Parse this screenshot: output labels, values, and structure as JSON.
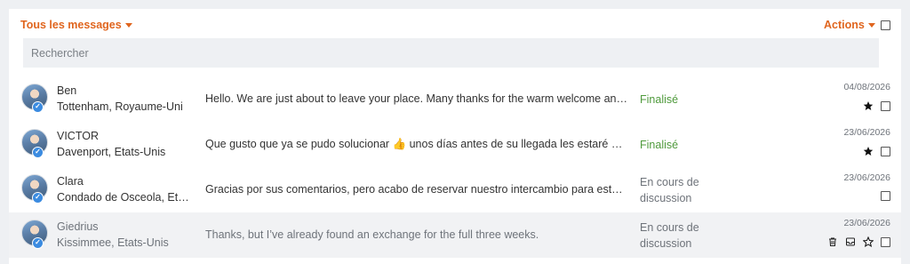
{
  "header": {
    "filter_label": "Tous les messages",
    "actions_label": "Actions"
  },
  "search": {
    "placeholder": "Rechercher"
  },
  "messages": [
    {
      "name": "Ben",
      "location": "Tottenham, Royaume-Uni",
      "preview": "Hello. We are just about to leave your place. Many thanks for the warm welcome and the great exchange!",
      "status": "Finalisé",
      "date": "04/08/2026",
      "starred": true
    },
    {
      "name": "VICTOR",
      "location": "Davenport, Etats-Unis",
      "preview": "Que gusto que ya se pudo solucionar 👍 unos días antes de su llegada les estaré enviando la información",
      "status": "Finalisé",
      "date": "23/06/2026",
      "starred": true
    },
    {
      "name": "Clara",
      "location": "Condado de Osceola, Etats-Unis",
      "preview": "Gracias por sus comentarios, pero acabo de reservar nuestro intercambio para estas fechas.",
      "status": "En cours de discussion",
      "date": "23/06/2026",
      "starred": false
    },
    {
      "name": "Giedrius",
      "location": "Kissimmee, Etats-Unis",
      "preview": "Thanks, but I’ve already found an exchange for the full three weeks.",
      "status": "En cours de discussion",
      "date": "23/06/2026",
      "starred": false
    }
  ],
  "colors": {
    "accent": "#e0651e",
    "finalised": "#4f9a3c",
    "verified_badge": "#3b8be0"
  },
  "icons": {
    "filter_caret": "chevron-down-icon",
    "actions_caret": "chevron-down-icon",
    "verified": "check-badge-icon",
    "star_filled": "star-filled-icon",
    "star_outline": "star-outline-icon",
    "trash": "trash-icon",
    "archive": "inbox-icon"
  }
}
